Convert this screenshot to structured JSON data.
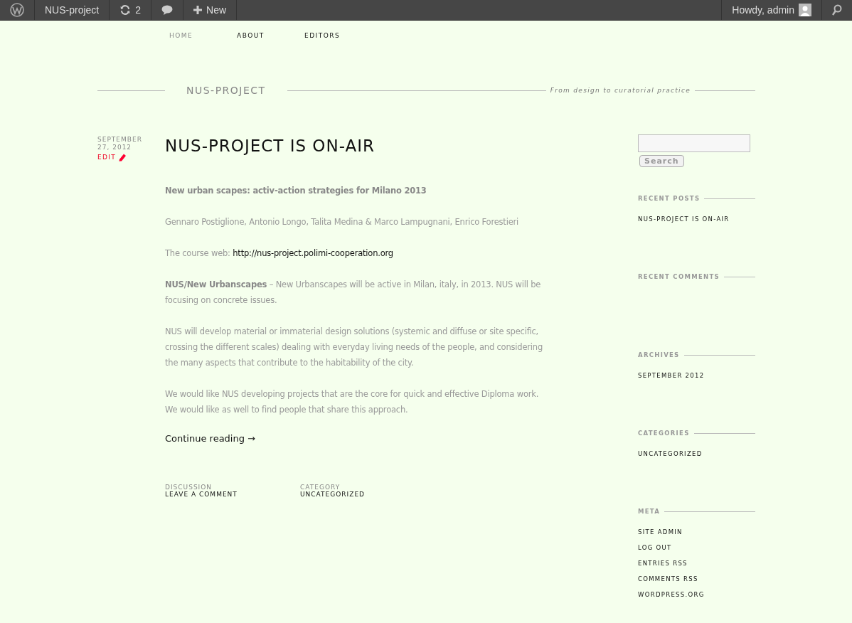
{
  "admin_bar": {
    "site": "NUS-project",
    "updates": "2",
    "new": "New",
    "greeting": "Howdy, admin"
  },
  "nav": [
    {
      "label": "HOME",
      "selected": true
    },
    {
      "label": "ABOUT",
      "selected": false
    },
    {
      "label": "EDITORS",
      "selected": false
    }
  ],
  "site": {
    "title": "NUS-PROJECT",
    "tagline": "From design to curatorial practice"
  },
  "post": {
    "date": "SEPTEMBER 27, 2012",
    "edit": "EDIT",
    "title": "NUS-PROJECT IS ON-AIR",
    "paragraphs": [
      {
        "kind": "lead",
        "text": "New urban scapes: activ-action strategies for Milano 2013"
      },
      {
        "kind": "text",
        "text": "Gennaro Postiglione, Antonio Longo, Talita Medina & Marco Lampugnani, Enrico Forestieri"
      },
      {
        "kind": "link",
        "text": "The course web:",
        "link": "http://nus-project.polimi-cooperation.org"
      },
      {
        "kind": "text",
        "text": "**NUS/New Urbanscapes** – New Urbanscapes will be active in Milan, italy, in 2013. NUS will be focusing on concrete issues."
      },
      {
        "kind": "text",
        "text": "NUS will develop material or immaterial design solutions (systemic and diffuse or site specific, crossing the different scales) dealing with everyday living needs of the people, and considering the many aspects that contribute to the habitability of the city."
      },
      {
        "kind": "text",
        "text": "We would like NUS developing projects that are the core for quick and effective Diploma work. We would like as well to find people that share this approach."
      }
    ],
    "continue": "Continue reading →",
    "meta": [
      {
        "label": "DISCUSSION",
        "value": "LEAVE A COMMENT"
      },
      {
        "label": "CATEGORY",
        "value": "UNCATEGORIZED"
      }
    ]
  },
  "sidebar": {
    "search_button": "Search",
    "widgets": [
      {
        "title": "RECENT POSTS",
        "items": [
          "NUS-PROJECT IS ON-AIR"
        ]
      },
      {
        "title": "RECENT COMMENTS"
      },
      {
        "title": "ARCHIVES",
        "items": [
          "SEPTEMBER 2012"
        ]
      },
      {
        "title": "CATEGORIES",
        "items": [
          "UNCATEGORIZED"
        ]
      },
      {
        "title": "META",
        "items": [
          "SITE ADMIN",
          "LOG OUT",
          "ENTRIES RSS",
          "COMMENTS RSS",
          "WORDPRESS.ORG"
        ]
      }
    ]
  }
}
